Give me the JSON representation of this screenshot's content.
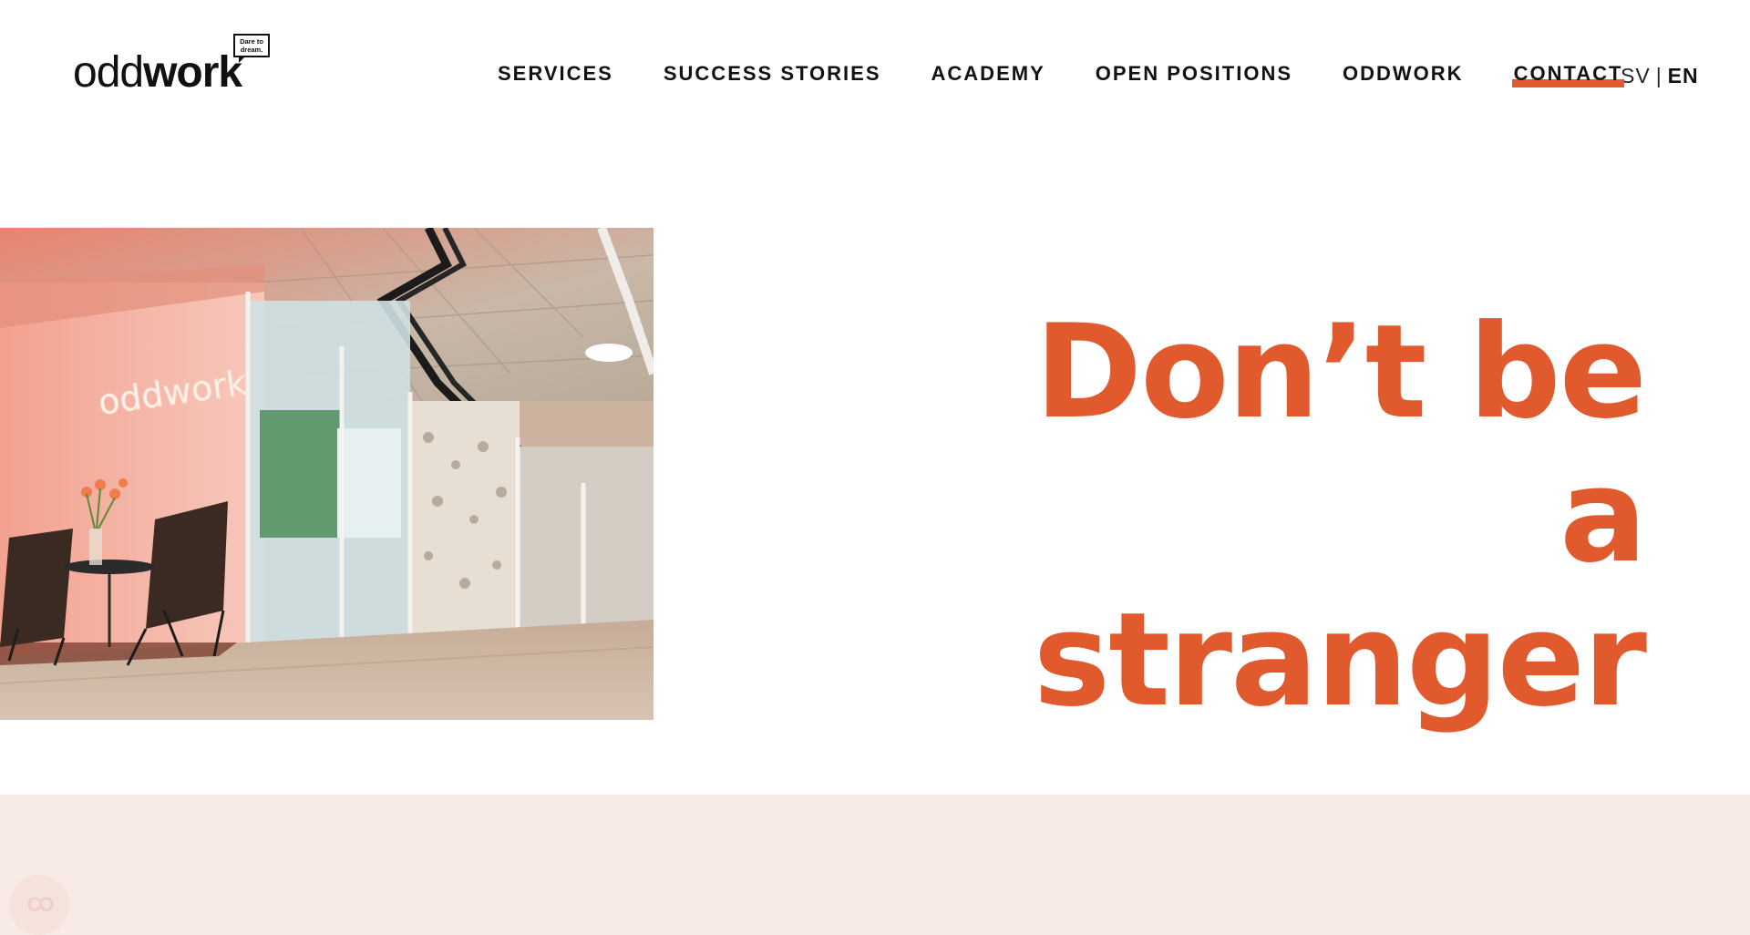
{
  "brand": {
    "logo_light": "odd",
    "logo_bold": "work",
    "tagline": "Dare to dream.",
    "accent_color": "#e15a2d",
    "band_color": "#f8ebe6"
  },
  "nav": {
    "items": [
      {
        "label": "SERVICES"
      },
      {
        "label": "SUCCESS STORIES"
      },
      {
        "label": "ACADEMY"
      },
      {
        "label": "OPEN POSITIONS"
      },
      {
        "label": "ODDWORK"
      },
      {
        "label": "CONTACT",
        "active": true
      }
    ]
  },
  "language": {
    "sv": "SV",
    "separator": "|",
    "en": "EN",
    "selected": "EN"
  },
  "hero": {
    "title": "Don’t be a stranger",
    "image_sign": "oddwork"
  },
  "cookie": {
    "icon_text": "CO"
  }
}
